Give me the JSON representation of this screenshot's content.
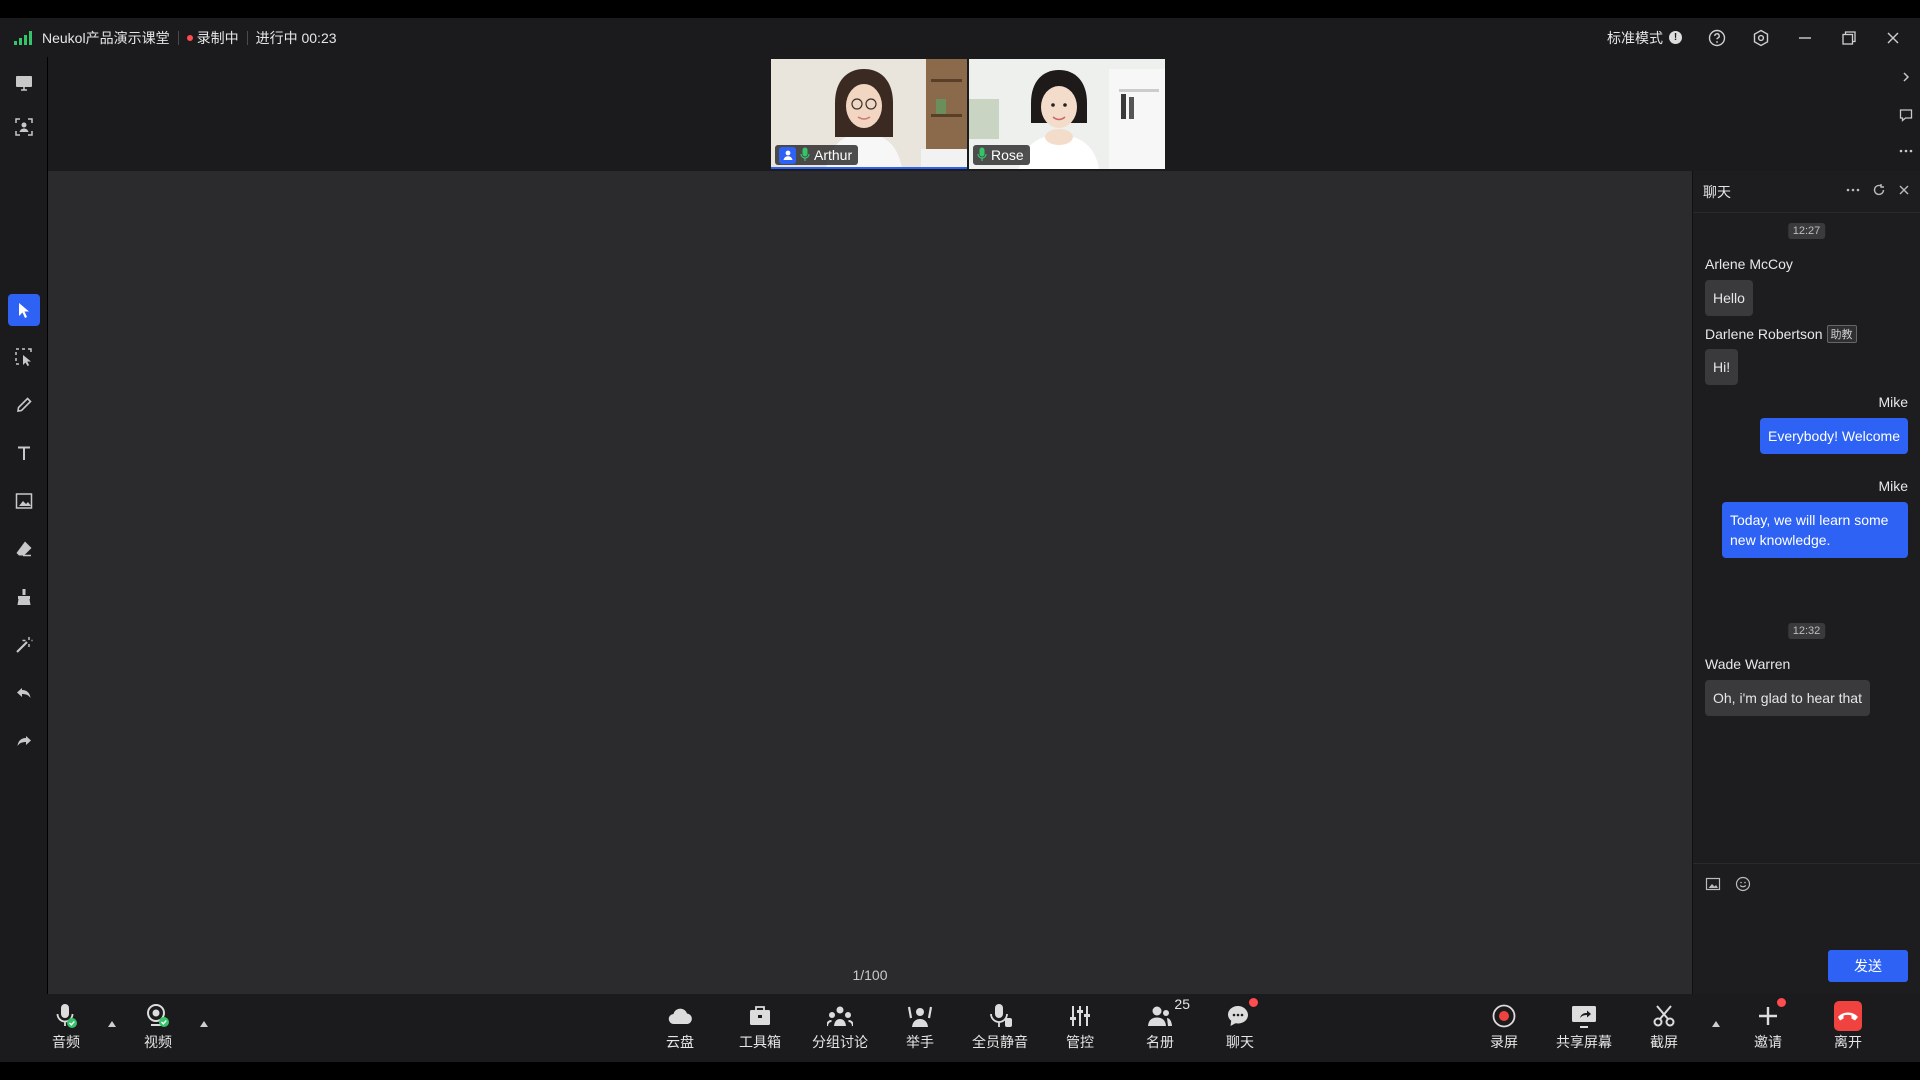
{
  "topbar": {
    "title": "Neukol产品演示课堂",
    "recording": "录制中",
    "status": "进行中 00:23",
    "mode": "标准模式"
  },
  "videos": [
    {
      "name": "Arthur",
      "role": "host"
    },
    {
      "name": "Rose"
    }
  ],
  "canvas": {
    "page": "1/100"
  },
  "chat": {
    "title": "聊天",
    "messages": {
      "t1": "12:27",
      "m1_sender": "Arlene McCoy",
      "m1_text": "Hello",
      "m2_sender": "Darlene Robertson",
      "m2_role": "助教",
      "m2_text": "Hi!",
      "m3_sender": "Mike",
      "m3_text": "Everybody! Welcome",
      "m4_sender": "Mike",
      "m4_text": "Today, we will learn some new knowledge.",
      "t2": "12:32",
      "m5_sender": "Wade Warren",
      "m5_text": "Oh, i'm glad to hear that"
    },
    "send_label": "发送"
  },
  "bottombar": {
    "audio": "音频",
    "video": "视频",
    "cloud": "云盘",
    "toolbox": "工具箱",
    "breakout": "分组讨论",
    "raise_hand": "举手",
    "mute_all": "全员静音",
    "control": "管控",
    "roster": "名册",
    "roster_count": "25",
    "chat": "聊天",
    "record": "录屏",
    "share": "共享屏幕",
    "screenshot": "截屏",
    "invite": "邀请",
    "leave": "离开"
  },
  "colors": {
    "accent": "#2d62f5",
    "danger": "#f0433f",
    "signal": "#35c46a"
  }
}
